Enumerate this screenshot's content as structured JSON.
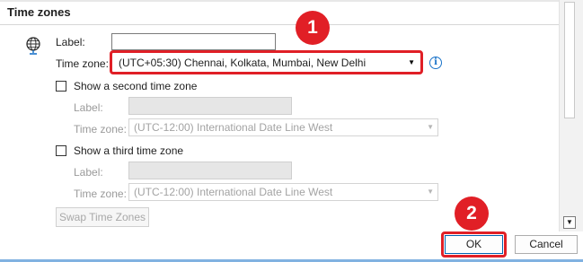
{
  "section": {
    "title": "Time zones"
  },
  "primary": {
    "label_caption": "Label:",
    "label_value": "",
    "timezone_caption": "Time zone:",
    "timezone_value": "(UTC+05:30) Chennai, Kolkata, Mumbai, New Delhi"
  },
  "second": {
    "checkbox_label": "Show a second time zone",
    "checked": false,
    "label_caption": "Label:",
    "timezone_caption": "Time zone:",
    "timezone_value": "(UTC-12:00) International Date Line West"
  },
  "third": {
    "checkbox_label": "Show a third time zone",
    "checked": false,
    "label_caption": "Label:",
    "timezone_caption": "Time zone:",
    "timezone_value": "(UTC-12:00) International Date Line West"
  },
  "buttons": {
    "swap": "Swap Time Zones",
    "ok": "OK",
    "cancel": "Cancel"
  },
  "callouts": {
    "step1": "1",
    "step2": "2"
  },
  "icons": {
    "globe": "globe-icon",
    "info": "info-icon",
    "dropdown": "chevron-down-icon",
    "scroll_down": "scroll-down-arrow-icon"
  },
  "colors": {
    "highlight": "#e01f26",
    "badge": "#e11f26",
    "info_blue": "#1a73c9"
  }
}
